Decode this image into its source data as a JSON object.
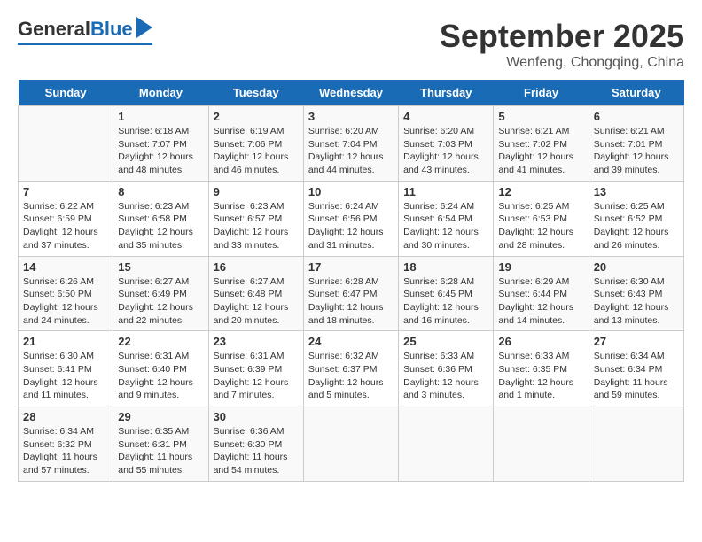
{
  "header": {
    "logo_general": "General",
    "logo_blue": "Blue",
    "month": "September 2025",
    "location": "Wenfeng, Chongqing, China"
  },
  "columns": [
    "Sunday",
    "Monday",
    "Tuesday",
    "Wednesday",
    "Thursday",
    "Friday",
    "Saturday"
  ],
  "weeks": [
    [
      {
        "day": "",
        "lines": []
      },
      {
        "day": "1",
        "lines": [
          "Sunrise: 6:18 AM",
          "Sunset: 7:07 PM",
          "Daylight: 12 hours",
          "and 48 minutes."
        ]
      },
      {
        "day": "2",
        "lines": [
          "Sunrise: 6:19 AM",
          "Sunset: 7:06 PM",
          "Daylight: 12 hours",
          "and 46 minutes."
        ]
      },
      {
        "day": "3",
        "lines": [
          "Sunrise: 6:20 AM",
          "Sunset: 7:04 PM",
          "Daylight: 12 hours",
          "and 44 minutes."
        ]
      },
      {
        "day": "4",
        "lines": [
          "Sunrise: 6:20 AM",
          "Sunset: 7:03 PM",
          "Daylight: 12 hours",
          "and 43 minutes."
        ]
      },
      {
        "day": "5",
        "lines": [
          "Sunrise: 6:21 AM",
          "Sunset: 7:02 PM",
          "Daylight: 12 hours",
          "and 41 minutes."
        ]
      },
      {
        "day": "6",
        "lines": [
          "Sunrise: 6:21 AM",
          "Sunset: 7:01 PM",
          "Daylight: 12 hours",
          "and 39 minutes."
        ]
      }
    ],
    [
      {
        "day": "7",
        "lines": [
          "Sunrise: 6:22 AM",
          "Sunset: 6:59 PM",
          "Daylight: 12 hours",
          "and 37 minutes."
        ]
      },
      {
        "day": "8",
        "lines": [
          "Sunrise: 6:23 AM",
          "Sunset: 6:58 PM",
          "Daylight: 12 hours",
          "and 35 minutes."
        ]
      },
      {
        "day": "9",
        "lines": [
          "Sunrise: 6:23 AM",
          "Sunset: 6:57 PM",
          "Daylight: 12 hours",
          "and 33 minutes."
        ]
      },
      {
        "day": "10",
        "lines": [
          "Sunrise: 6:24 AM",
          "Sunset: 6:56 PM",
          "Daylight: 12 hours",
          "and 31 minutes."
        ]
      },
      {
        "day": "11",
        "lines": [
          "Sunrise: 6:24 AM",
          "Sunset: 6:54 PM",
          "Daylight: 12 hours",
          "and 30 minutes."
        ]
      },
      {
        "day": "12",
        "lines": [
          "Sunrise: 6:25 AM",
          "Sunset: 6:53 PM",
          "Daylight: 12 hours",
          "and 28 minutes."
        ]
      },
      {
        "day": "13",
        "lines": [
          "Sunrise: 6:25 AM",
          "Sunset: 6:52 PM",
          "Daylight: 12 hours",
          "and 26 minutes."
        ]
      }
    ],
    [
      {
        "day": "14",
        "lines": [
          "Sunrise: 6:26 AM",
          "Sunset: 6:50 PM",
          "Daylight: 12 hours",
          "and 24 minutes."
        ]
      },
      {
        "day": "15",
        "lines": [
          "Sunrise: 6:27 AM",
          "Sunset: 6:49 PM",
          "Daylight: 12 hours",
          "and 22 minutes."
        ]
      },
      {
        "day": "16",
        "lines": [
          "Sunrise: 6:27 AM",
          "Sunset: 6:48 PM",
          "Daylight: 12 hours",
          "and 20 minutes."
        ]
      },
      {
        "day": "17",
        "lines": [
          "Sunrise: 6:28 AM",
          "Sunset: 6:47 PM",
          "Daylight: 12 hours",
          "and 18 minutes."
        ]
      },
      {
        "day": "18",
        "lines": [
          "Sunrise: 6:28 AM",
          "Sunset: 6:45 PM",
          "Daylight: 12 hours",
          "and 16 minutes."
        ]
      },
      {
        "day": "19",
        "lines": [
          "Sunrise: 6:29 AM",
          "Sunset: 6:44 PM",
          "Daylight: 12 hours",
          "and 14 minutes."
        ]
      },
      {
        "day": "20",
        "lines": [
          "Sunrise: 6:30 AM",
          "Sunset: 6:43 PM",
          "Daylight: 12 hours",
          "and 13 minutes."
        ]
      }
    ],
    [
      {
        "day": "21",
        "lines": [
          "Sunrise: 6:30 AM",
          "Sunset: 6:41 PM",
          "Daylight: 12 hours",
          "and 11 minutes."
        ]
      },
      {
        "day": "22",
        "lines": [
          "Sunrise: 6:31 AM",
          "Sunset: 6:40 PM",
          "Daylight: 12 hours",
          "and 9 minutes."
        ]
      },
      {
        "day": "23",
        "lines": [
          "Sunrise: 6:31 AM",
          "Sunset: 6:39 PM",
          "Daylight: 12 hours",
          "and 7 minutes."
        ]
      },
      {
        "day": "24",
        "lines": [
          "Sunrise: 6:32 AM",
          "Sunset: 6:37 PM",
          "Daylight: 12 hours",
          "and 5 minutes."
        ]
      },
      {
        "day": "25",
        "lines": [
          "Sunrise: 6:33 AM",
          "Sunset: 6:36 PM",
          "Daylight: 12 hours",
          "and 3 minutes."
        ]
      },
      {
        "day": "26",
        "lines": [
          "Sunrise: 6:33 AM",
          "Sunset: 6:35 PM",
          "Daylight: 12 hours",
          "and 1 minute."
        ]
      },
      {
        "day": "27",
        "lines": [
          "Sunrise: 6:34 AM",
          "Sunset: 6:34 PM",
          "Daylight: 11 hours",
          "and 59 minutes."
        ]
      }
    ],
    [
      {
        "day": "28",
        "lines": [
          "Sunrise: 6:34 AM",
          "Sunset: 6:32 PM",
          "Daylight: 11 hours",
          "and 57 minutes."
        ]
      },
      {
        "day": "29",
        "lines": [
          "Sunrise: 6:35 AM",
          "Sunset: 6:31 PM",
          "Daylight: 11 hours",
          "and 55 minutes."
        ]
      },
      {
        "day": "30",
        "lines": [
          "Sunrise: 6:36 AM",
          "Sunset: 6:30 PM",
          "Daylight: 11 hours",
          "and 54 minutes."
        ]
      },
      {
        "day": "",
        "lines": []
      },
      {
        "day": "",
        "lines": []
      },
      {
        "day": "",
        "lines": []
      },
      {
        "day": "",
        "lines": []
      }
    ]
  ]
}
